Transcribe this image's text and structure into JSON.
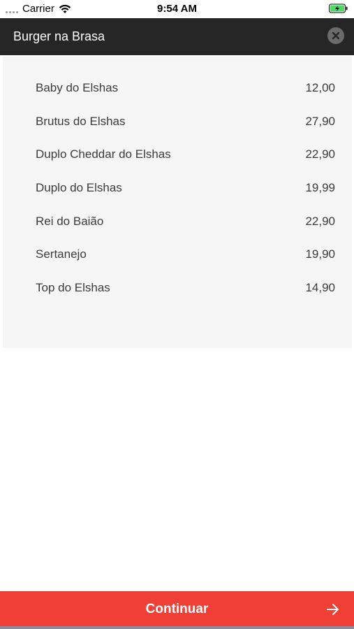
{
  "status_bar": {
    "carrier": "Carrier",
    "time": "9:54 AM"
  },
  "header": {
    "title": "Burger na Brasa"
  },
  "menu": {
    "items": [
      {
        "name": "Baby do Elshas",
        "price": "12,00"
      },
      {
        "name": "Brutus do Elshas",
        "price": "27,90"
      },
      {
        "name": "Duplo Cheddar do Elshas",
        "price": "22,90"
      },
      {
        "name": "Duplo do Elshas",
        "price": "19,99"
      },
      {
        "name": "Rei do Baião",
        "price": "22,90"
      },
      {
        "name": "Sertanejo",
        "price": "19,90"
      },
      {
        "name": "Top do Elshas",
        "price": "14,90"
      }
    ]
  },
  "footer": {
    "continue_label": "Continuar"
  },
  "icons": {
    "close": "close-icon",
    "arrow": "arrow-right-icon",
    "wifi": "wifi-icon",
    "battery": "battery-charging-icon"
  },
  "colors": {
    "header_bg": "#262626",
    "accent": "#f04036",
    "card_bg": "#f6f6f7"
  }
}
